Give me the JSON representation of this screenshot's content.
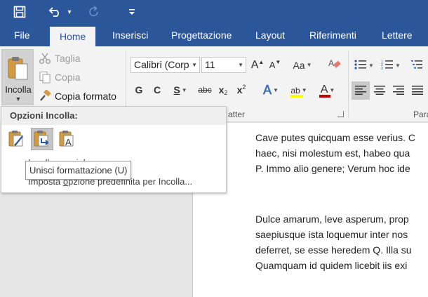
{
  "qat": {
    "save": "save-icon",
    "undo": "undo-icon",
    "undo_dd": "▾",
    "redo": "redo-icon",
    "customize": "customize-icon"
  },
  "tabs": [
    {
      "label": "File"
    },
    {
      "label": "Home"
    },
    {
      "label": "Inserisci"
    },
    {
      "label": "Progettazione"
    },
    {
      "label": "Layout"
    },
    {
      "label": "Riferimenti"
    },
    {
      "label": "Lettere"
    }
  ],
  "clipboard": {
    "paste_label": "Incolla",
    "cut_label": "Taglia",
    "copy_label": "Copia",
    "format_painter_label": "Copia formato"
  },
  "font": {
    "font_name": "Calibri (Corp",
    "font_size": "11",
    "group_label_partial": "atter",
    "grow": "A",
    "shrink": "A",
    "case": "Aa",
    "bold": "G",
    "italic": "C",
    "underline": "S",
    "strike": "abc",
    "subscript": "x",
    "subscript_mark": "2",
    "superscript": "x",
    "superscript_mark": "2",
    "effects": "A",
    "highlight": "ab",
    "font_color": "A",
    "highlight_color": "#ffff00",
    "font_color_value": "#c00000"
  },
  "paragraph": {
    "group_label_partial": "Para"
  },
  "paste_menu": {
    "header": "Opzioni Incolla:",
    "hidden_line": "Incolla speciale...",
    "default_prefix": "Imposta ",
    "default_underlined": "o",
    "default_suffix": "pzione predefinita per Incolla...",
    "tooltip": "Unisci formattazione (U)"
  },
  "document": {
    "paragraph1": [
      "Cave putes quicquam esse verius. C",
      "haec, nisi molestum est, habeo qua",
      "P. Immo alio genere; Verum hoc ide"
    ],
    "paragraph2": [
      "Dulce amarum, leve asperum, prop",
      "saepiusque ista loquemur inter nos",
      "deferret, se esse heredem Q. Illa su",
      "Quamquam id quidem licebit iis exi"
    ]
  },
  "colors": {
    "accent": "#2b579a",
    "ribbon": "#f3f3f3"
  }
}
